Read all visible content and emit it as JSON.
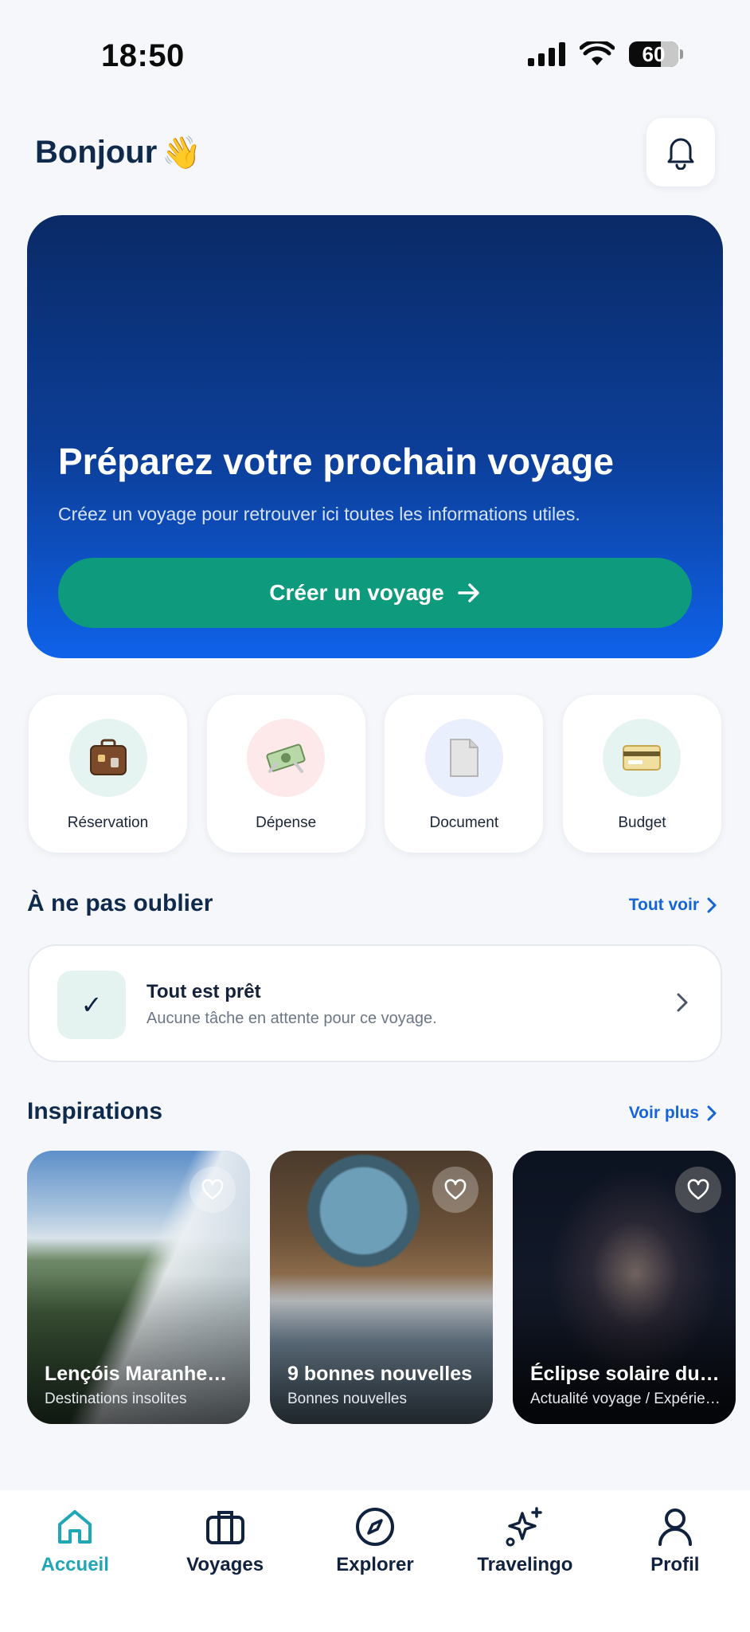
{
  "status_bar": {
    "time": "18:50",
    "battery": "60"
  },
  "header": {
    "greeting": "Bonjour",
    "greeting_emoji": "👋"
  },
  "hero": {
    "title": "Préparez votre prochain voyage",
    "subtitle": "Créez un voyage pour retrouver ici toutes les informations utiles.",
    "cta_label": "Créer un voyage"
  },
  "quick_actions": [
    {
      "label": "Réservation",
      "icon": "luggage-icon",
      "bg": "#e6f4f1"
    },
    {
      "label": "Dépense",
      "icon": "money-icon",
      "bg": "#fde9ea"
    },
    {
      "label": "Document",
      "icon": "document-icon",
      "bg": "#e9effc"
    },
    {
      "label": "Budget",
      "icon": "credit-card-icon",
      "bg": "#e6f4f1"
    }
  ],
  "reminders": {
    "title": "À ne pas oublier",
    "link": "Tout voir",
    "task_title": "Tout est prêt",
    "task_subtitle": "Aucune tâche en attente pour ce voyage."
  },
  "inspirations": {
    "title": "Inspirations",
    "link": "Voir plus",
    "cards": [
      {
        "title": "Lençóis Maranhenses",
        "category": "Destinations insolites"
      },
      {
        "title": "9 bonnes nouvelles",
        "category": "Bonnes nouvelles"
      },
      {
        "title": "Éclipse solaire du siècle",
        "category": "Actualité voyage / Expériences"
      }
    ]
  },
  "bottom_nav": [
    {
      "label": "Accueil",
      "icon": "home-icon",
      "active": true
    },
    {
      "label": "Voyages",
      "icon": "briefcase-icon",
      "active": false
    },
    {
      "label": "Explorer",
      "icon": "compass-icon",
      "active": false
    },
    {
      "label": "Travelingo",
      "icon": "sparkle-icon",
      "active": false
    },
    {
      "label": "Profil",
      "icon": "user-icon",
      "active": false
    }
  ],
  "colors": {
    "accent": "#1565d8",
    "primary_dark": "#102a4c",
    "cta": "#0e9a7c",
    "nav_active": "#21a6b5"
  }
}
